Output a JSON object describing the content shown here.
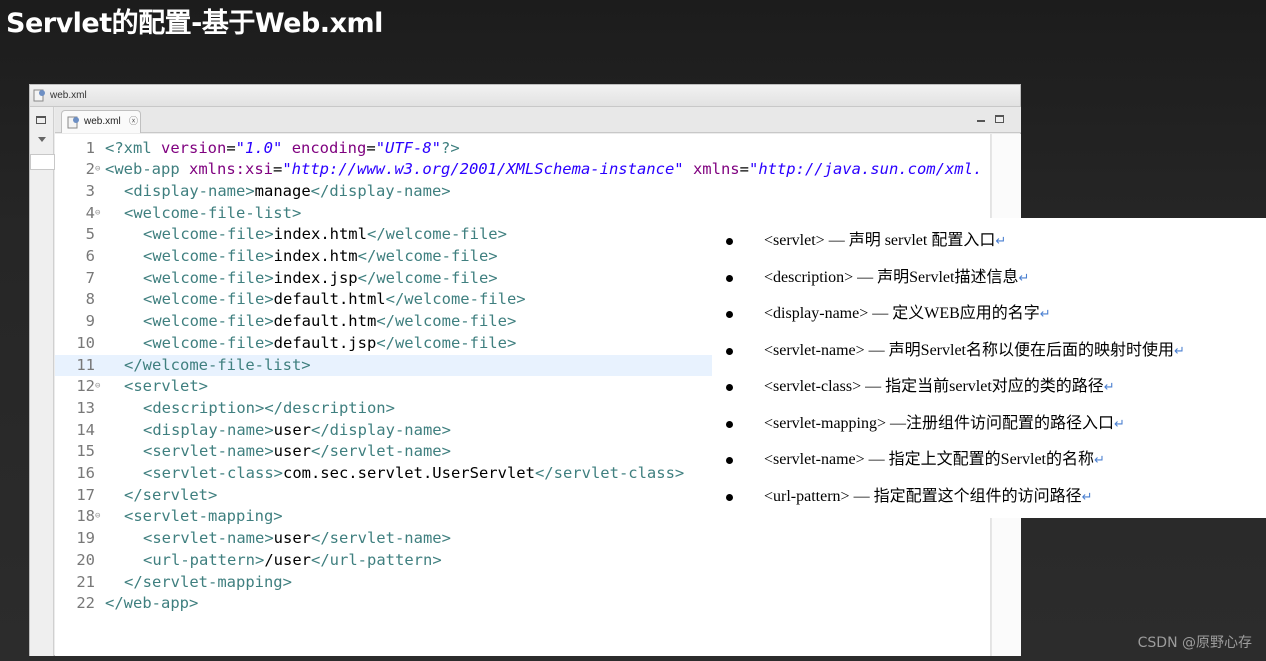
{
  "slide": {
    "title": "Servlet的配置-基于Web.xml"
  },
  "window": {
    "title": "web.xml",
    "tab_label": "web.xml",
    "tab_close": "ⓧ"
  },
  "editor": {
    "highlighted_line": 11,
    "lines": [
      {
        "num": "1",
        "fold": "",
        "indent": 0,
        "tokens": [
          [
            "t",
            "<?"
          ],
          [
            "t",
            "xml "
          ],
          [
            "a",
            "version"
          ],
          [
            "x",
            "="
          ],
          [
            "v",
            "\"1.0\""
          ],
          [
            "x",
            " "
          ],
          [
            "a",
            "encoding"
          ],
          [
            "x",
            "="
          ],
          [
            "v",
            "\"UTF-8\""
          ],
          [
            "t",
            "?>"
          ]
        ]
      },
      {
        "num": "2",
        "fold": "⊖",
        "indent": 0,
        "tokens": [
          [
            "t",
            "<web-app "
          ],
          [
            "a",
            "xmlns:xsi"
          ],
          [
            "x",
            "="
          ],
          [
            "v",
            "\"http://www.w3.org/2001/XMLSchema-instance\""
          ],
          [
            "x",
            " "
          ],
          [
            "a",
            "xmlns"
          ],
          [
            "x",
            "="
          ],
          [
            "v",
            "\"http://java.sun.com/xml."
          ]
        ]
      },
      {
        "num": "3",
        "fold": "",
        "indent": 1,
        "tokens": [
          [
            "t",
            "<display-name>"
          ],
          [
            "x",
            "manage"
          ],
          [
            "t",
            "</display-name>"
          ]
        ]
      },
      {
        "num": "4",
        "fold": "⊖",
        "indent": 1,
        "tokens": [
          [
            "t",
            "<welcome-file-list>"
          ]
        ]
      },
      {
        "num": "5",
        "fold": "",
        "indent": 2,
        "tokens": [
          [
            "t",
            "<welcome-file>"
          ],
          [
            "x",
            "index.html"
          ],
          [
            "t",
            "</welcome-file>"
          ]
        ]
      },
      {
        "num": "6",
        "fold": "",
        "indent": 2,
        "tokens": [
          [
            "t",
            "<welcome-file>"
          ],
          [
            "x",
            "index.htm"
          ],
          [
            "t",
            "</welcome-file>"
          ]
        ]
      },
      {
        "num": "7",
        "fold": "",
        "indent": 2,
        "tokens": [
          [
            "t",
            "<welcome-file>"
          ],
          [
            "x",
            "index.jsp"
          ],
          [
            "t",
            "</welcome-file>"
          ]
        ]
      },
      {
        "num": "8",
        "fold": "",
        "indent": 2,
        "tokens": [
          [
            "t",
            "<welcome-file>"
          ],
          [
            "x",
            "default.html"
          ],
          [
            "t",
            "</welcome-file>"
          ]
        ]
      },
      {
        "num": "9",
        "fold": "",
        "indent": 2,
        "tokens": [
          [
            "t",
            "<welcome-file>"
          ],
          [
            "x",
            "default.htm"
          ],
          [
            "t",
            "</welcome-file>"
          ]
        ]
      },
      {
        "num": "10",
        "fold": "",
        "indent": 2,
        "tokens": [
          [
            "t",
            "<welcome-file>"
          ],
          [
            "x",
            "default.jsp"
          ],
          [
            "t",
            "</welcome-file>"
          ]
        ]
      },
      {
        "num": "11",
        "fold": "",
        "indent": 1,
        "tokens": [
          [
            "t",
            "</welcome-file-list>"
          ]
        ]
      },
      {
        "num": "12",
        "fold": "⊖",
        "indent": 1,
        "tokens": [
          [
            "t",
            "<servlet>"
          ]
        ]
      },
      {
        "num": "13",
        "fold": "",
        "indent": 2,
        "tokens": [
          [
            "t",
            "<description></description>"
          ]
        ]
      },
      {
        "num": "14",
        "fold": "",
        "indent": 2,
        "tokens": [
          [
            "t",
            "<display-name>"
          ],
          [
            "x",
            "user"
          ],
          [
            "t",
            "</display-name>"
          ]
        ]
      },
      {
        "num": "15",
        "fold": "",
        "indent": 2,
        "tokens": [
          [
            "t",
            "<servlet-name>"
          ],
          [
            "x",
            "user"
          ],
          [
            "t",
            "</servlet-name>"
          ]
        ]
      },
      {
        "num": "16",
        "fold": "",
        "indent": 2,
        "tokens": [
          [
            "t",
            "<servlet-class>"
          ],
          [
            "x",
            "com.sec.servlet.UserServlet"
          ],
          [
            "t",
            "</servlet-class>"
          ]
        ]
      },
      {
        "num": "17",
        "fold": "",
        "indent": 1,
        "tokens": [
          [
            "t",
            "</servlet>"
          ]
        ]
      },
      {
        "num": "18",
        "fold": "⊖",
        "indent": 1,
        "tokens": [
          [
            "t",
            "<servlet-mapping>"
          ]
        ]
      },
      {
        "num": "19",
        "fold": "",
        "indent": 2,
        "tokens": [
          [
            "t",
            "<servlet-name>"
          ],
          [
            "x",
            "user"
          ],
          [
            "t",
            "</servlet-name>"
          ]
        ]
      },
      {
        "num": "20",
        "fold": "",
        "indent": 2,
        "tokens": [
          [
            "t",
            "<url-pattern>"
          ],
          [
            "x",
            "/user"
          ],
          [
            "t",
            "</url-pattern>"
          ]
        ]
      },
      {
        "num": "21",
        "fold": "",
        "indent": 1,
        "tokens": [
          [
            "t",
            "</servlet-mapping>"
          ]
        ]
      },
      {
        "num": "22",
        "fold": "",
        "indent": 0,
        "tokens": [
          [
            "t",
            "</web-app>"
          ]
        ]
      }
    ]
  },
  "notes": {
    "return_mark": "↵",
    "items": [
      "<servlet> — 声明  servlet  配置入口",
      "<description> — 声明Servlet描述信息",
      "<display-name>   — 定义WEB应用的名字",
      "<servlet-name> — 声明Servlet名称以便在后面的映射时使用",
      "<servlet-class> — 指定当前servlet对应的类的路径",
      "<servlet-mapping>   —注册组件访问配置的路径入口",
      "<servlet-name> — 指定上文配置的Servlet的名称",
      "<url-pattern> — 指定配置这个组件的访问路径"
    ]
  },
  "watermark": "CSDN @原野心存",
  "colors": {
    "tag": "#3f7f7f",
    "attribute": "#7f007f",
    "value": "#2a00ff",
    "highlight": "#e8f2fe"
  }
}
